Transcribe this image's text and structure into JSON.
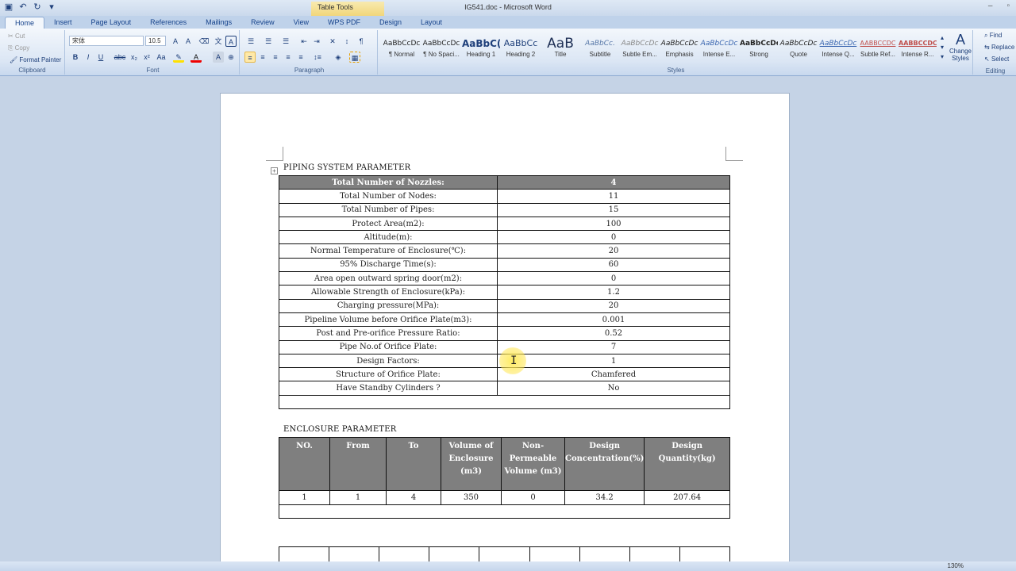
{
  "window": {
    "title": "IG541.doc - Microsoft Word",
    "context_tab_group": "Table Tools"
  },
  "tabs": [
    "Home",
    "Insert",
    "Page Layout",
    "References",
    "Mailings",
    "Review",
    "View",
    "WPS PDF",
    "Design",
    "Layout"
  ],
  "ribbon": {
    "clipboard": {
      "label": "Clipboard",
      "cut": "Cut",
      "copy": "Copy",
      "format_painter": "Format Painter"
    },
    "font": {
      "label": "Font",
      "font_name": "宋体",
      "font_size": "10.5"
    },
    "paragraph": {
      "label": "Paragraph"
    },
    "styles": {
      "label": "Styles",
      "items": [
        {
          "sample": "AaBbCcDc",
          "name": "¶ Normal"
        },
        {
          "sample": "AaBbCcDc",
          "name": "¶ No Spaci..."
        },
        {
          "sample": "AaBbC(",
          "name": "Heading 1"
        },
        {
          "sample": "AaBbCc",
          "name": "Heading 2"
        },
        {
          "sample": "AaB",
          "name": "Title"
        },
        {
          "sample": "AaBbCc.",
          "name": "Subtitle"
        },
        {
          "sample": "AaBbCcDc",
          "name": "Subtle Em..."
        },
        {
          "sample": "AaBbCcDc",
          "name": "Emphasis"
        },
        {
          "sample": "AaBbCcDc",
          "name": "Intense E..."
        },
        {
          "sample": "AaBbCcDc",
          "name": "Strong"
        },
        {
          "sample": "AaBbCcDc",
          "name": "Quote"
        },
        {
          "sample": "AaBbCcDc",
          "name": "Intense Q..."
        },
        {
          "sample": "AABBCCDC",
          "name": "Subtle Ref..."
        },
        {
          "sample": "AABBCCDC",
          "name": "Intense R..."
        }
      ],
      "change_styles": "Change Styles"
    },
    "editing": {
      "label": "Editing",
      "find": "Find",
      "replace": "Replace",
      "select": "Select"
    }
  },
  "document": {
    "piping_title": "PIPING SYSTEM PARAMETER",
    "piping_rows": [
      {
        "label": "Total Number of Nozzles:",
        "value": "4"
      },
      {
        "label": "Total Number of Nodes:",
        "value": "11"
      },
      {
        "label": "Total Number of Pipes:",
        "value": "15"
      },
      {
        "label": "Protect Area(m2):",
        "value": "100"
      },
      {
        "label": "Altitude(m):",
        "value": "0"
      },
      {
        "label": "Normal Temperature of Enclosure(℃):",
        "value": "20"
      },
      {
        "label": "95% Discharge Time(s):",
        "value": "60"
      },
      {
        "label": "Area open outward spring door(m2):",
        "value": "0"
      },
      {
        "label": "Allowable Strength of Enclosure(kPa):",
        "value": "1.2"
      },
      {
        "label": "Charging pressure(MPa):",
        "value": "20"
      },
      {
        "label": "Pipeline Volume before Orifice Plate(m3):",
        "value": "0.001"
      },
      {
        "label": "Post and Pre-orifice Pressure Ratio:",
        "value": "0.52"
      },
      {
        "label": "Pipe No.of Orifice Plate:",
        "value": "7"
      },
      {
        "label": "Design Factors:",
        "value": "1"
      },
      {
        "label": "Structure of Orifice Plate:",
        "value": "Chamfered"
      },
      {
        "label": "Have Standby Cylinders ?",
        "value": "No"
      }
    ],
    "enclosure_title": "ENCLOSURE PARAMETER",
    "enclosure_headers": [
      "NO.",
      "From",
      "To",
      "Volume of Enclosure (m3)",
      "Non-Permeable Volume (m3)",
      "Design Concentration(%)",
      "Design Quantity(kg)"
    ],
    "enclosure_rows": [
      [
        "1",
        "1",
        "4",
        "350",
        "0",
        "34.2",
        "207.64"
      ]
    ]
  },
  "status": {
    "zoom": "130%"
  }
}
